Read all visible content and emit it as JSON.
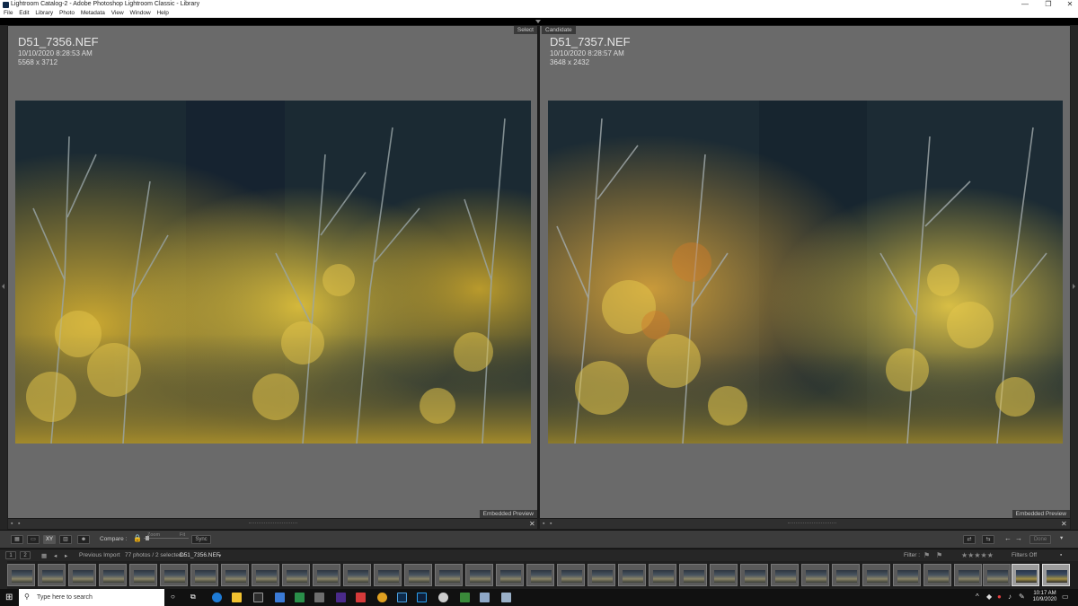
{
  "window": {
    "title": "Lightroom Catalog-2 - Adobe Photoshop Lightroom Classic - Library",
    "minimize": "—",
    "maximize": "❐",
    "close": "✕"
  },
  "menu": [
    "File",
    "Edit",
    "Library",
    "Photo",
    "Metadata",
    "View",
    "Window",
    "Help"
  ],
  "compare": {
    "left": {
      "badge": "Select",
      "filename": "D51_7356.NEF",
      "datetime": "10/10/2020 8:28:53 AM",
      "dimensions": "5568 x 3712",
      "preview": "Embedded Preview"
    },
    "right": {
      "badge": "Candidate",
      "filename": "D51_7357.NEF",
      "datetime": "10/10/2020 8:28:57 AM",
      "dimensions": "3648 x 2432",
      "preview": "Embedded Preview"
    }
  },
  "toolbar": {
    "compare_label": "Compare :",
    "zoom_label": "Zoom",
    "fit_label": "Fit",
    "sync_label": "Sync",
    "done_label": "Done",
    "view_xy_label": "XY"
  },
  "filmbar": {
    "page1": "1",
    "page2": "2",
    "source": "Previous Import",
    "status": "77 photos / 2 selected /",
    "current_file": "D51_7356.NEF",
    "filter_label": "Filter :",
    "filters_off": "Filters Off"
  },
  "taskbar": {
    "search_placeholder": "Type here to search",
    "time": "10:17 AM",
    "date": "10/9/2020"
  },
  "icons": {
    "search": "search-icon",
    "windows": "windows-start-icon",
    "lock": "lock-icon"
  },
  "colors": {
    "pane_gray": "#6a6a6a",
    "panel_dark": "#3c3c3c",
    "foliage_yellow": "#d6b53a",
    "forest_dark": "#1f2f38"
  }
}
